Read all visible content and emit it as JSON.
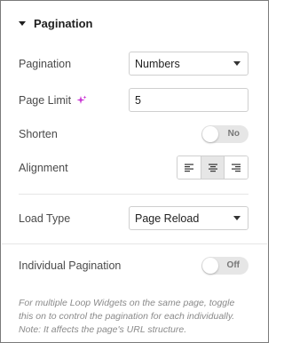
{
  "section": {
    "title": "Pagination"
  },
  "pagination": {
    "label": "Pagination",
    "value": "Numbers"
  },
  "page_limit": {
    "label": "Page Limit",
    "value": "5"
  },
  "shorten": {
    "label": "Shorten",
    "toggle_text": "No"
  },
  "alignment": {
    "label": "Alignment",
    "options": [
      "left",
      "center",
      "right"
    ],
    "selected": "center"
  },
  "load_type": {
    "label": "Load Type",
    "value": "Page Reload"
  },
  "individual_pagination": {
    "label": "Individual Pagination",
    "toggle_text": "Off"
  },
  "note": {
    "line1": "For multiple Loop Widgets on the same page, toggle",
    "line2": "this on to control the pagination for each individually.",
    "line3": "Note: It affects the page's URL structure."
  },
  "colors": {
    "ai_sparkle": "#c935d4",
    "toggle_bg": "#e6e6e6"
  }
}
